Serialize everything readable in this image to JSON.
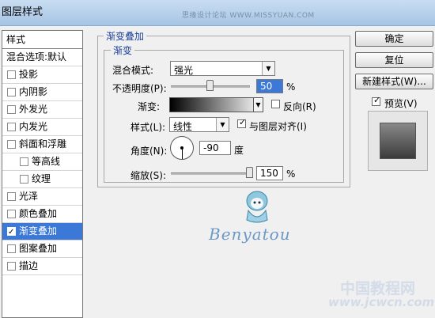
{
  "window": {
    "title": "图层样式",
    "watermark": "思缘设计论坛 WWW.MISSYUAN.COM"
  },
  "left_panel": {
    "header": "样式",
    "items": [
      {
        "label": "混合选项:默认",
        "checkbox": false,
        "checked": false,
        "indent": 0,
        "active": false
      },
      {
        "label": "投影",
        "checkbox": true,
        "checked": false,
        "indent": 0,
        "active": false
      },
      {
        "label": "内阴影",
        "checkbox": true,
        "checked": false,
        "indent": 0,
        "active": false
      },
      {
        "label": "外发光",
        "checkbox": true,
        "checked": false,
        "indent": 0,
        "active": false
      },
      {
        "label": "内发光",
        "checkbox": true,
        "checked": false,
        "indent": 0,
        "active": false
      },
      {
        "label": "斜面和浮雕",
        "checkbox": true,
        "checked": false,
        "indent": 0,
        "active": false
      },
      {
        "label": "等高线",
        "checkbox": true,
        "checked": false,
        "indent": 1,
        "active": false
      },
      {
        "label": "纹理",
        "checkbox": true,
        "checked": false,
        "indent": 1,
        "active": false
      },
      {
        "label": "光泽",
        "checkbox": true,
        "checked": false,
        "indent": 0,
        "active": false
      },
      {
        "label": "颜色叠加",
        "checkbox": true,
        "checked": false,
        "indent": 0,
        "active": false
      },
      {
        "label": "渐变叠加",
        "checkbox": true,
        "checked": true,
        "indent": 0,
        "active": true
      },
      {
        "label": "图案叠加",
        "checkbox": true,
        "checked": false,
        "indent": 0,
        "active": false
      },
      {
        "label": "描边",
        "checkbox": true,
        "checked": false,
        "indent": 0,
        "active": false
      }
    ]
  },
  "gradient_overlay": {
    "group_title": "渐变叠加",
    "subgroup_title": "渐变",
    "blend_mode_label": "混合模式:",
    "blend_mode_value": "强光",
    "opacity_label": "不透明度(P):",
    "opacity_value": "50",
    "opacity_fraction": 0.5,
    "percent": "%",
    "gradient_label": "渐变:",
    "reverse_label": "反向(R)",
    "reverse_checked": false,
    "style_label": "样式(L):",
    "style_value": "线性",
    "align_label": "与图层对齐(I)",
    "align_checked": true,
    "angle_label": "角度(N):",
    "angle_value": "-90",
    "angle_unit": "度",
    "scale_label": "缩放(S):",
    "scale_value": "150",
    "scale_fraction": 1.0
  },
  "right_panel": {
    "ok_label": "确定",
    "reset_label": "复位",
    "new_style_label": "新建样式(W)...",
    "preview_label": "预览(V)",
    "preview_checked": true
  },
  "overlay": {
    "brand": "Benyatou",
    "watermark_cn": "中国教程网",
    "watermark_url": "www.jcwcn.com"
  },
  "colors": {
    "accent": "#3b78d8",
    "group_title": "#1a3e9a"
  }
}
